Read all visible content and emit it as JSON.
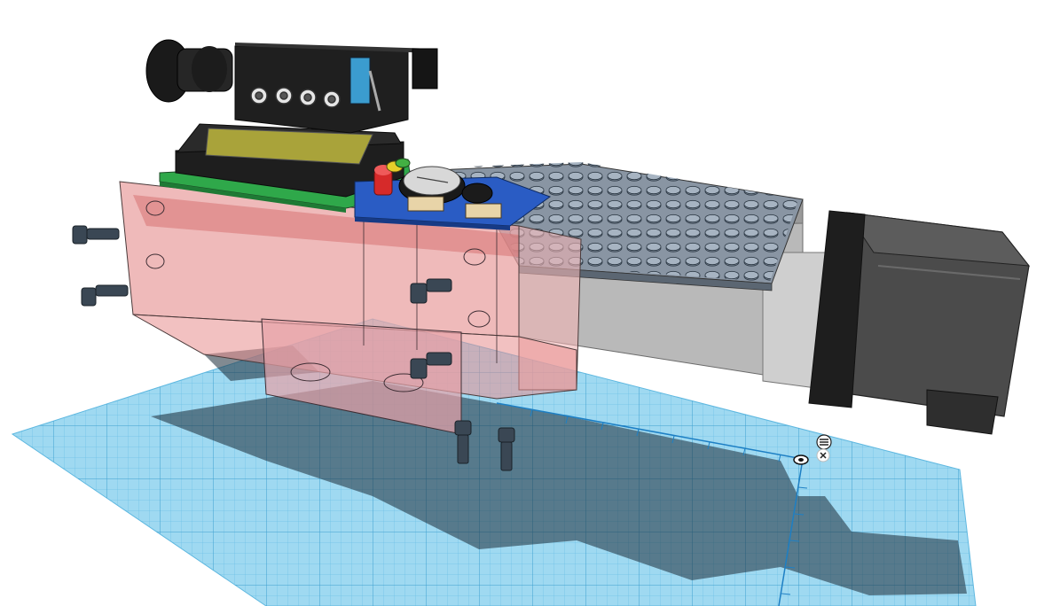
{
  "app": {
    "view": "3d-workplane"
  },
  "workplane": {
    "grid_color": "#8fd3ef",
    "grid_line_color": "#3aa6d6",
    "ruler_color": "#1d7fc4"
  },
  "colors": {
    "pcb_green": "#2fa84a",
    "pcb_blue": "#2a5cc4",
    "lcd_frame": "#1e1e1e",
    "lcd_screen": "#a9a33a",
    "red_housing": "#e88a8a",
    "grey_housing": "#b8b8b8",
    "motor_dark": "#3c3c3c",
    "led_red": "#d62a2a",
    "led_yellow": "#e6cf2a",
    "led_green": "#43b043",
    "screw": "#33414d",
    "limit_switch": "#3b9ccf"
  },
  "icons": {
    "ruler_menu": "list-icon",
    "ruler_close": "close-icon",
    "ruler_origin": "target-icon"
  }
}
